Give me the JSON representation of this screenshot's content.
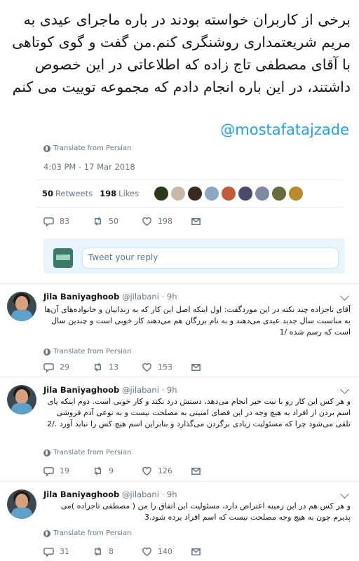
{
  "main": {
    "text": "برخی از کاربران خواسته بودند در باره ماجرای عیدی به مریم شریعتمداری روشنگری کنم.من گفت و گوی کوتاهی با آقای مصطفی تاج زاده که اطلاعاتی در این خصوص داشتند، در این باره انجام دادم که مجموعه توییت می کنم",
    "mention": "@mostafatajzade",
    "translate": "Translate from Persian",
    "timestamp": "4:03 PM - 17 Mar 2018",
    "retweets_count": "50",
    "retweets_label": "Retweets",
    "likes_count": "198",
    "likes_label": "Likes",
    "likers_colors": [
      "#2a3a1a",
      "#c9b8a8",
      "#3a2a22",
      "#8aa8c0",
      "#c45a3a",
      "#4a4a6a",
      "#7a8aa0",
      "#6a6a3a",
      "#b88a2a"
    ],
    "actions": {
      "replies": "83",
      "retweets": "50",
      "likes": "198"
    },
    "reply_placeholder": "Tweet your reply"
  },
  "replies": [
    {
      "name": "Jila Baniyaghoob",
      "handle": "@jilabani · 9h",
      "text": "آقای تاجزاده چند نکته در این موردگفت: اول اینکه اصل این کار که به زندانیان و خانواده‌های آن‌ها به مناسبت سال جدید عیدی می‌دهند و به نام بزرگان هم می‌دهند کار خوبی است و چندین سال است که رسم شده /1",
      "translate": "Translate from Persian",
      "replies": "29",
      "retweets": "13",
      "likes": "153"
    },
    {
      "name": "Jila Baniyaghoob",
      "handle": "@jilabani · 9h",
      "text": "و هر کس این کار رو با نیت خیر انجام می‌دهد، دستش درد نکند و کار خوبی است. دوم اینکه پای اسم بردن از افراد به هیچ وجه در این فضای امنیتی به مصلحت نیست و به نوعی آدم فروشی تلقی می‌شود چرا که مسئولیت زیادی برگردن می‌گذارد و بنابراین اسم هیچ کس را نباید آورد ./2",
      "translate": "Translate from Persian",
      "replies": "19",
      "retweets": "9",
      "likes": "126"
    },
    {
      "name": "Jila Baniyaghoob",
      "handle": "@jilabani · 9h",
      "text": "و هر کس هم در این زمینه اعتراض دارد، مسئولیت این اتفاق را من ( مصطفی تاجزاده )می پذیرم چون به هیچ وجه مصلحت نیست که اسم افراد برده شود.3",
      "translate": "Translate from Persian",
      "replies": "31",
      "retweets": "8",
      "likes": "140"
    }
  ]
}
